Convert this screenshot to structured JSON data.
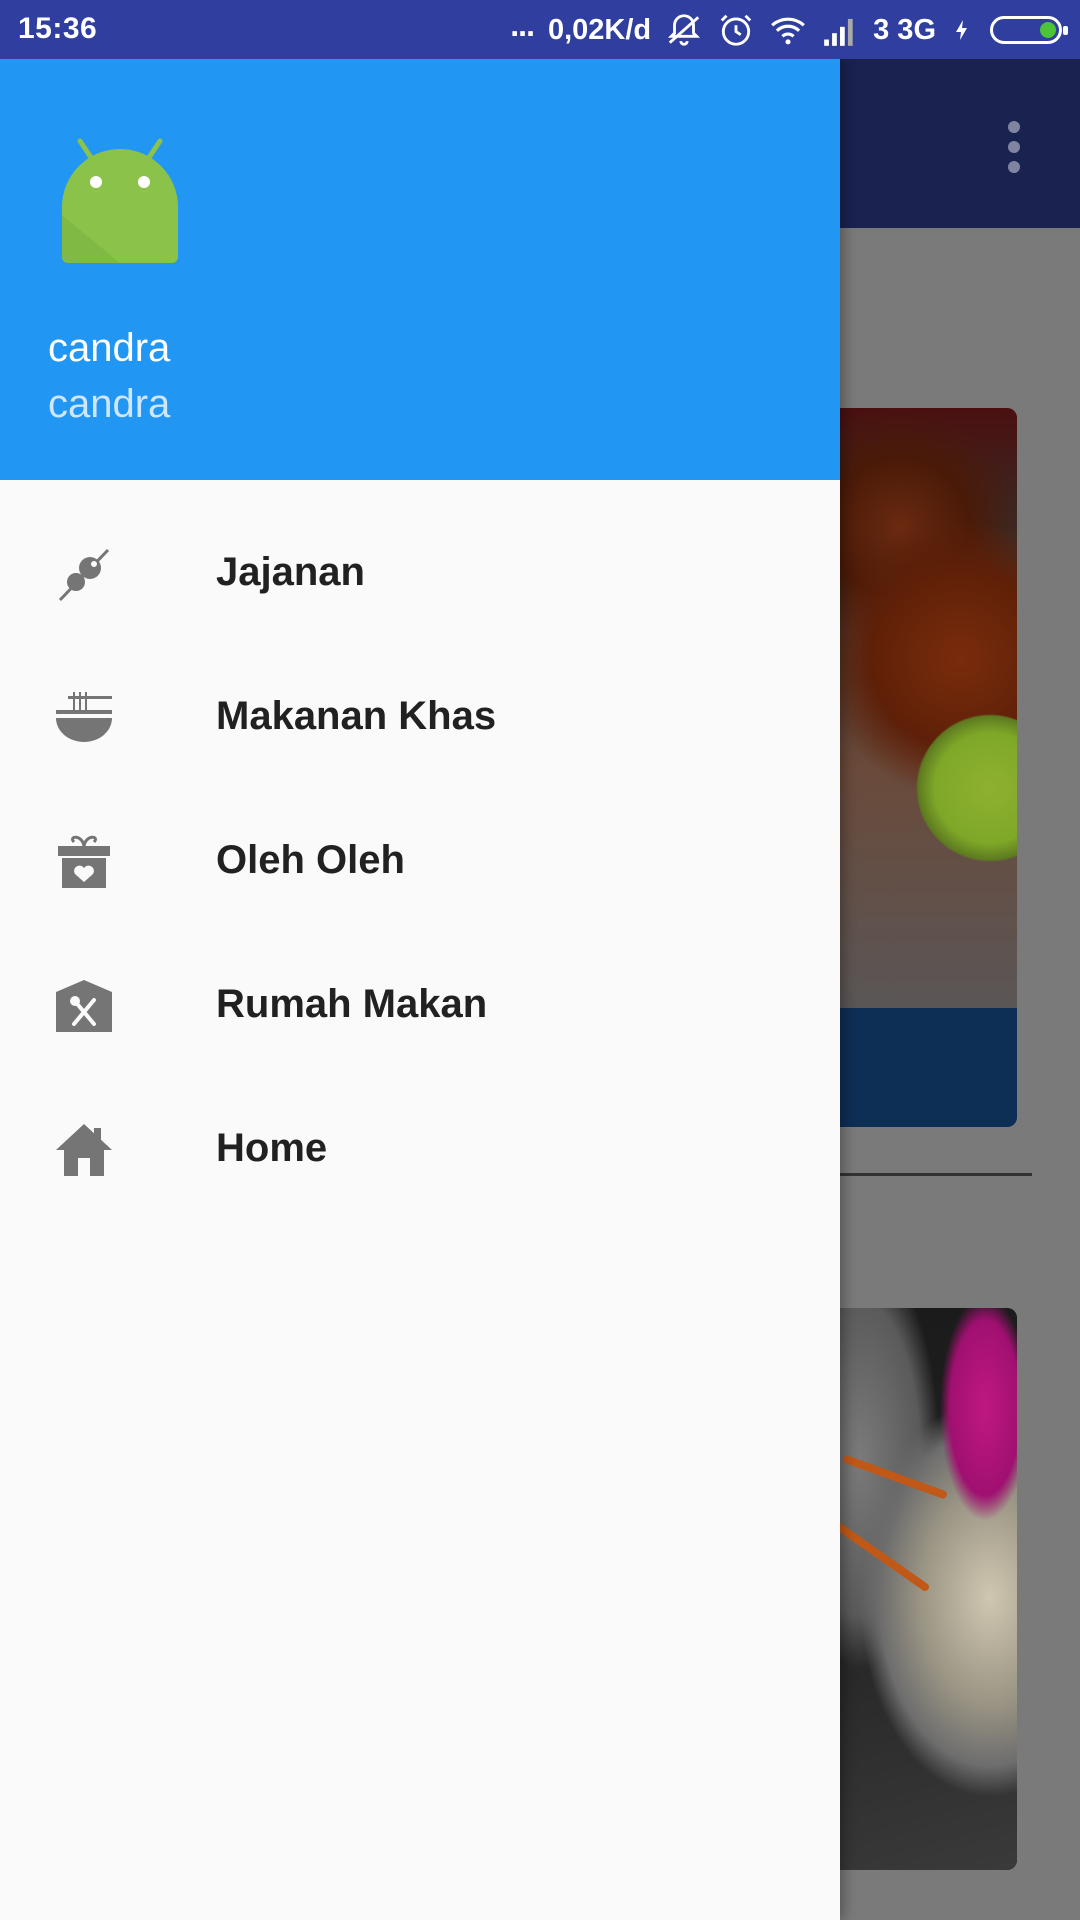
{
  "status_bar": {
    "time": "15:36",
    "dots": "...",
    "network_speed": "0,02K/d",
    "carrier": "3 3G",
    "icons": [
      "vibrate-off-icon",
      "alarm-icon",
      "wifi-icon",
      "signal-icon",
      "charging-icon",
      "battery-icon"
    ]
  },
  "drawer": {
    "header": {
      "avatar": "android-avatar-icon",
      "name": "candra",
      "email": "candra"
    },
    "items": [
      {
        "label": "Jajanan",
        "icon": "skewer-icon"
      },
      {
        "label": "Makanan Khas",
        "icon": "noodle-bowl-icon"
      },
      {
        "label": "Oleh Oleh",
        "icon": "gift-icon"
      },
      {
        "label": "Rumah Makan",
        "icon": "restaurant-icon"
      },
      {
        "label": "Home",
        "icon": "home-icon"
      }
    ]
  },
  "colors": {
    "status_bar": "#303F9F",
    "drawer_header": "#2196F3",
    "drawer_bg": "#FAFAFA",
    "menu_text": "#212121",
    "icon_gray": "#757575"
  },
  "background_app": {
    "toolbar_menu": "more-vert-icon"
  }
}
